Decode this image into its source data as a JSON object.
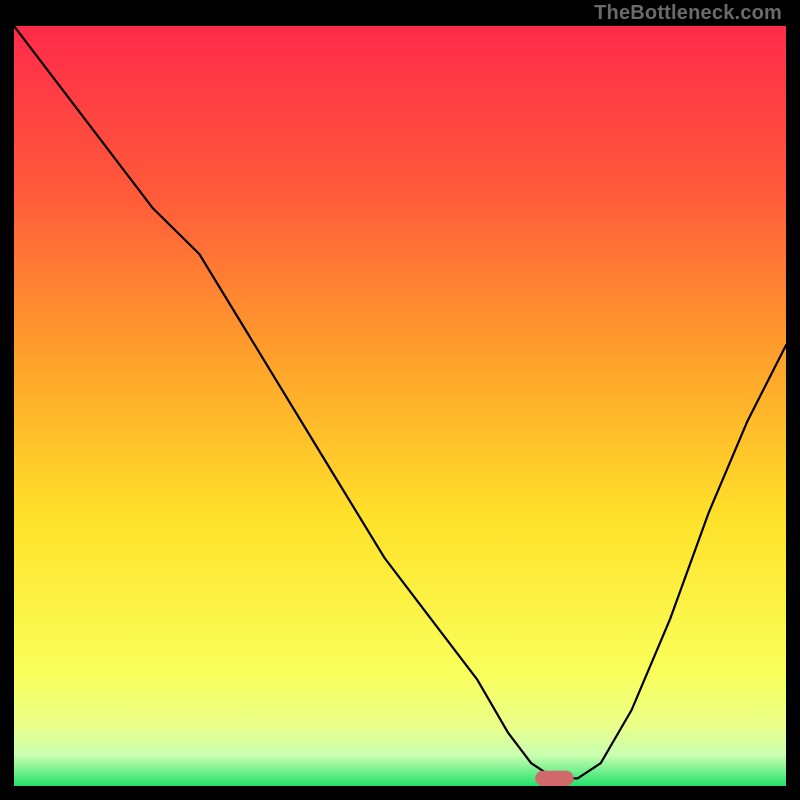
{
  "watermark": "TheBottleneck.com",
  "chart_data": {
    "type": "line",
    "title": "",
    "xlabel": "",
    "ylabel": "",
    "xlim": [
      0,
      100
    ],
    "ylim": [
      0,
      100
    ],
    "grid": false,
    "legend": false,
    "gradient": {
      "top": "#ff2a4a",
      "mid_upper": "#ff8a2a",
      "mid": "#ffe22a",
      "mid_lower": "#f6ff6a",
      "band": "#d8ffb0",
      "bottom": "#23e06a"
    },
    "series": [
      {
        "name": "bottleneck-curve",
        "color": "#000000",
        "x": [
          0,
          6,
          12,
          18,
          24,
          30,
          36,
          42,
          48,
          54,
          60,
          64,
          67,
          70,
          73,
          76,
          80,
          85,
          90,
          95,
          100
        ],
        "y": [
          100,
          92,
          84,
          76,
          70,
          60,
          50,
          40,
          30,
          22,
          14,
          7,
          3,
          1,
          1,
          3,
          10,
          22,
          36,
          48,
          58
        ]
      }
    ],
    "marker": {
      "name": "optimal-marker",
      "shape": "rounded-bar",
      "color": "#d06a6a",
      "x_center": 70,
      "y": 0,
      "width_pct": 5,
      "height_pct": 2
    }
  }
}
